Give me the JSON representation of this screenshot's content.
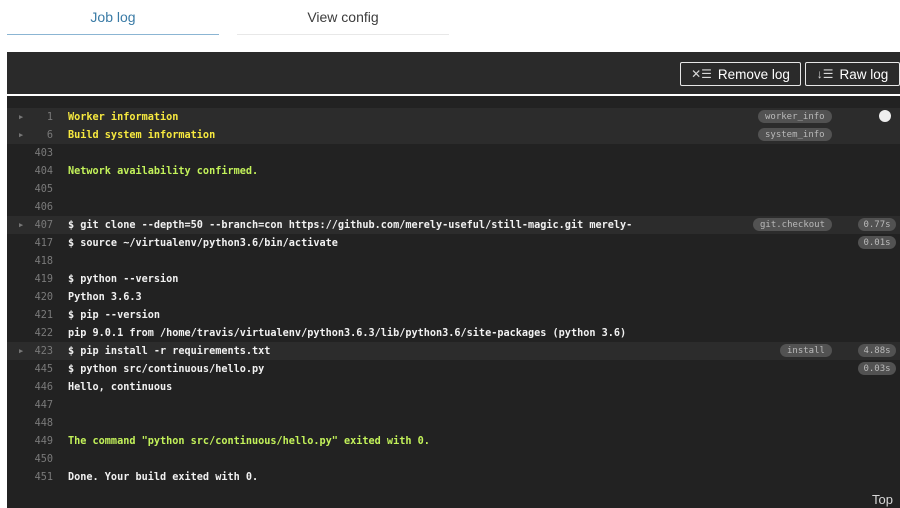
{
  "tabs": [
    {
      "label": "Job log",
      "active": true
    },
    {
      "label": "View config",
      "active": false
    }
  ],
  "toolbar": {
    "remove_log": "Remove log",
    "remove_icon": "remove-log-icon",
    "raw_log": "Raw log",
    "raw_icon": "raw-log-icon"
  },
  "colors": {
    "terminal_bg": "#222222",
    "fold_bg": "#2c2c2c",
    "yellow": "#f7e93f",
    "green": "#c3f25a",
    "badge_bg": "#525252",
    "active_tab": "#3a7ba6"
  },
  "log": [
    {
      "num": "1",
      "text": "Worker information",
      "color": "yellow",
      "fold": true,
      "badge": "worker_info"
    },
    {
      "num": "6",
      "text": "Build system information",
      "color": "yellow",
      "fold": true,
      "badge": "system_info"
    },
    {
      "num": "403",
      "text": ""
    },
    {
      "num": "404",
      "text": "Network availability confirmed.",
      "color": "green"
    },
    {
      "num": "405",
      "text": ""
    },
    {
      "num": "406",
      "text": ""
    },
    {
      "num": "407",
      "text": "$ git clone --depth=50 --branch=con https://github.com/merely-useful/still-magic.git merely-",
      "fold": true,
      "badge": "git.checkout",
      "time": "0.77s"
    },
    {
      "num": "417",
      "text": "$ source ~/virtualenv/python3.6/bin/activate",
      "time": "0.01s"
    },
    {
      "num": "418",
      "text": ""
    },
    {
      "num": "419",
      "text": "$ python --version"
    },
    {
      "num": "420",
      "text": "Python 3.6.3"
    },
    {
      "num": "421",
      "text": "$ pip --version"
    },
    {
      "num": "422",
      "text": "pip 9.0.1 from /home/travis/virtualenv/python3.6.3/lib/python3.6/site-packages (python 3.6)"
    },
    {
      "num": "423",
      "text": "$ pip install -r requirements.txt",
      "fold": true,
      "badge": "install",
      "time": "4.88s"
    },
    {
      "num": "445",
      "text": "$ python src/continuous/hello.py",
      "time": "0.03s"
    },
    {
      "num": "446",
      "text": "Hello, continuous"
    },
    {
      "num": "447",
      "text": ""
    },
    {
      "num": "448",
      "text": ""
    },
    {
      "num": "449",
      "text": "The command \"python src/continuous/hello.py\" exited with 0.",
      "color": "green"
    },
    {
      "num": "450",
      "text": ""
    },
    {
      "num": "451",
      "text": "Done. Your build exited with 0."
    }
  ],
  "footer": {
    "top_label": "Top"
  }
}
